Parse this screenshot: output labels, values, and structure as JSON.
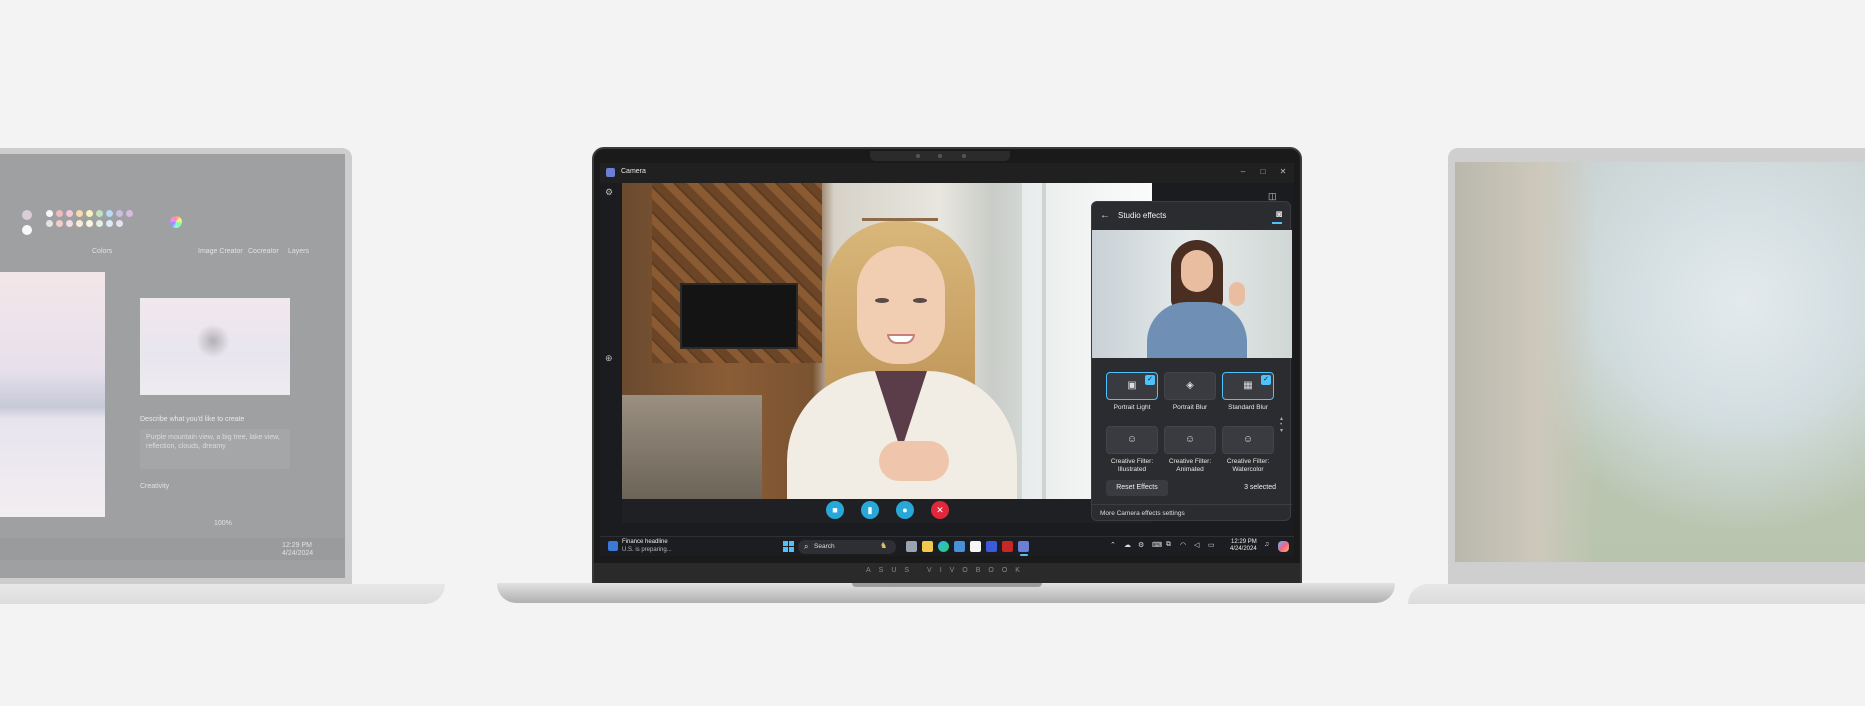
{
  "window": {
    "title": "Camera",
    "buttons": [
      "–",
      "□",
      "✕"
    ]
  },
  "rail": {
    "settings_icon": "gear-icon",
    "zoom_icon": "zoom-in-icon"
  },
  "call_controls": [
    {
      "name": "video-call-button",
      "icon": "video-icon",
      "color": "#27a8d8"
    },
    {
      "name": "stats-button",
      "icon": "bar-chart-icon",
      "color": "#27a8d8"
    },
    {
      "name": "chat-button",
      "icon": "chat-icon",
      "color": "#27a8d8"
    },
    {
      "name": "end-call-button",
      "icon": "close-icon",
      "color": "#e0283a"
    }
  ],
  "studio_effects": {
    "title": "Studio effects",
    "effects": [
      {
        "label": "Portrait Light",
        "selected": true
      },
      {
        "label": "Portrait Blur",
        "selected": false
      },
      {
        "label": "Standard Blur",
        "selected": true
      },
      {
        "label": "Creative Filter: Illustrated",
        "selected": false
      },
      {
        "label": "Creative Filter: Animated",
        "selected": false
      },
      {
        "label": "Creative Filter: Watercolor",
        "selected": false
      }
    ],
    "reset_label": "Reset Effects",
    "selected_count": "3 selected",
    "more_settings_label": "More Camera effects settings"
  },
  "taskbar": {
    "news_title": "Finance headline",
    "news_subtitle": "U.S. is preparing...",
    "search_placeholder": "Search",
    "time": "12:29 PM",
    "date": "4/24/2024"
  },
  "laptop": {
    "brand": "ASUS VIVOBOOK"
  },
  "left_laptop": {
    "palette_label": "Colors",
    "tool_image_creator": "Image Creator",
    "tool_cocreator": "Cocreator",
    "tool_layers": "Layers",
    "describe_label": "Describe what you'd like to create",
    "prompt_text": "Purple mountain view, a big tree, lake view, reflection, clouds, dreamy",
    "creativity_label": "Creativity",
    "zoom_text": "100%",
    "time": "12:29 PM",
    "date": "4/24/2024"
  },
  "colors": {
    "accent": "#4cc2ff",
    "end_call": "#e0283a"
  }
}
